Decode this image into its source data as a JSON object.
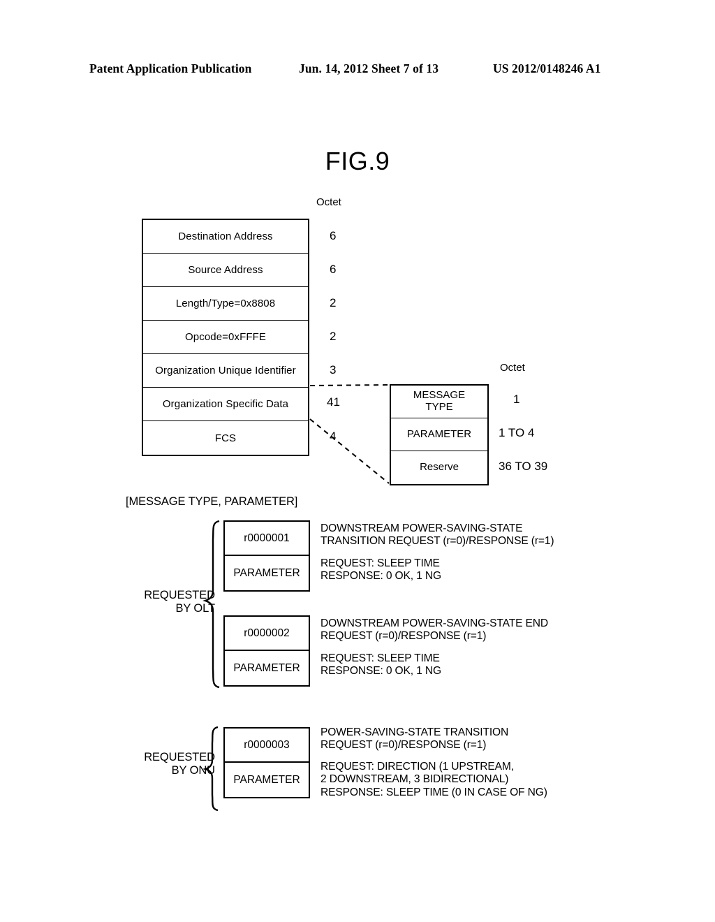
{
  "header": {
    "left": "Patent Application Publication",
    "middle": "Jun. 14, 2012  Sheet 7 of 13",
    "right": "US 2012/0148246 A1"
  },
  "figure": {
    "title": "FIG.9"
  },
  "main_table": {
    "octet_header": "Octet",
    "rows": [
      {
        "label": "Destination Address",
        "octet": "6"
      },
      {
        "label": "Source Address",
        "octet": "6"
      },
      {
        "label": "Length/Type=0x8808",
        "octet": "2"
      },
      {
        "label": "Opcode=0xFFFE",
        "octet": "2"
      },
      {
        "label": "Organization Unique Identifier",
        "octet": "3"
      },
      {
        "label": "Organization Specific Data",
        "octet": "41"
      },
      {
        "label": "FCS",
        "octet": "4"
      }
    ]
  },
  "detail_table": {
    "octet_header": "Octet",
    "rows": [
      {
        "label": "MESSAGE\nTYPE",
        "label_line1": "MESSAGE",
        "label_line2": "TYPE",
        "octet": "1"
      },
      {
        "label": "PARAMETER",
        "octet": "1 TO 4"
      },
      {
        "label": "Reserve",
        "octet": "36 TO 39"
      }
    ]
  },
  "message_section": {
    "heading": "[MESSAGE TYPE, PARAMETER]",
    "groups": [
      {
        "requester_label_line1": "REQUESTED",
        "requester_label_line2": "BY OLT",
        "entries": [
          {
            "code": "r0000001",
            "parameter_label": "PARAMETER",
            "description_line1": "DOWNSTREAM POWER-SAVING-STATE",
            "description_line2": "TRANSITION REQUEST (r=0)/RESPONSE (r=1)",
            "parameter_line1": "REQUEST: SLEEP TIME",
            "parameter_line2": "RESPONSE: 0 OK, 1 NG"
          },
          {
            "code": "r0000002",
            "parameter_label": "PARAMETER",
            "description_line1": "DOWNSTREAM POWER-SAVING-STATE END",
            "description_line2": "REQUEST (r=0)/RESPONSE (r=1)",
            "parameter_line1": "REQUEST: SLEEP TIME",
            "parameter_line2": "RESPONSE: 0 OK, 1 NG"
          }
        ]
      },
      {
        "requester_label_line1": "REQUESTED",
        "requester_label_line2": "BY ONU",
        "entries": [
          {
            "code": "r0000003",
            "parameter_label": "PARAMETER",
            "description_line1": "POWER-SAVING-STATE TRANSITION",
            "description_line2": "REQUEST (r=0)/RESPONSE (r=1)",
            "parameter_line1": "REQUEST: DIRECTION (1 UPSTREAM,",
            "parameter_line2": "2 DOWNSTREAM, 3 BIDIRECTIONAL)",
            "parameter_line3": "RESPONSE: SLEEP TIME (0 IN CASE OF NG)"
          }
        ]
      }
    ]
  },
  "colors": {
    "ink": "#000000",
    "paper": "#ffffff"
  }
}
